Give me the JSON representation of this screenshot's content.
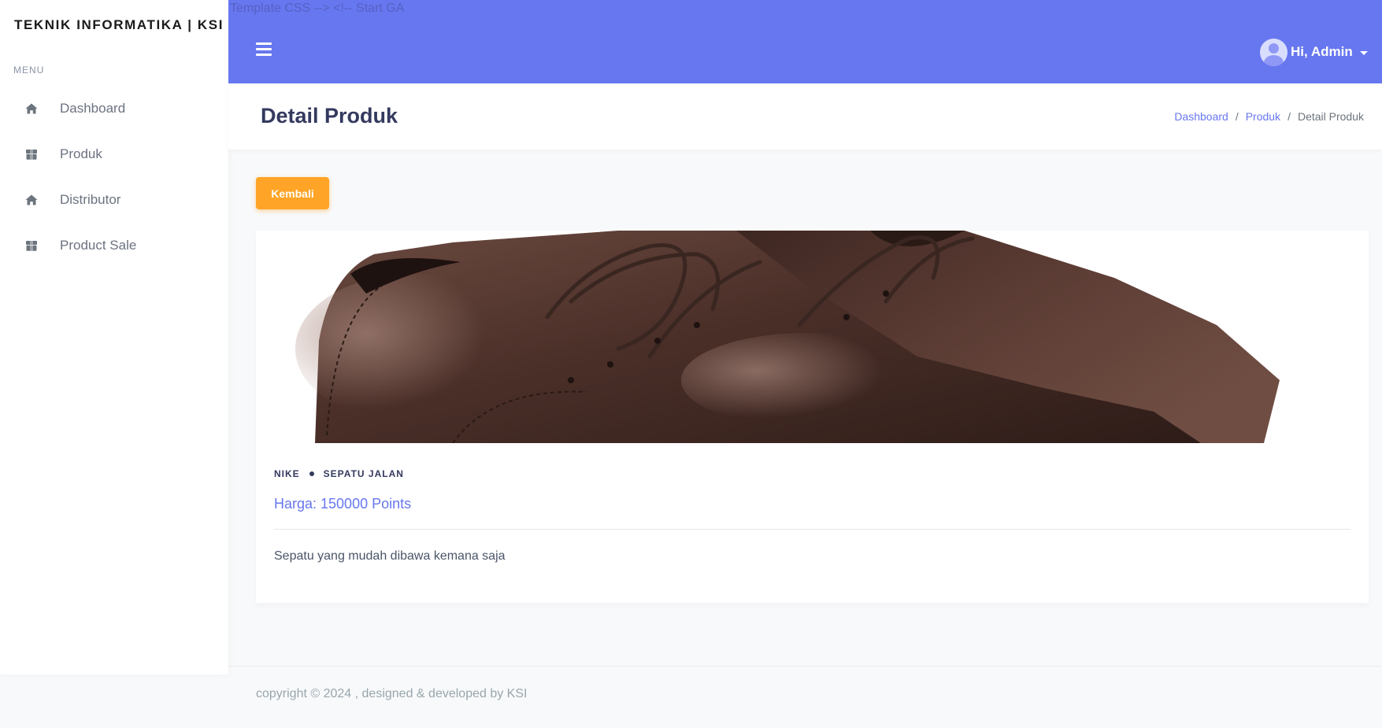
{
  "sidebar": {
    "brand": "TEKNIK INFORMATIKA | KSI",
    "menu_title": "MENU",
    "items": [
      {
        "label": "Dashboard",
        "icon": "home-icon"
      },
      {
        "label": "Produk",
        "icon": "box-icon"
      },
      {
        "label": "Distributor",
        "icon": "home-icon"
      },
      {
        "label": "Product Sale",
        "icon": "box-icon"
      }
    ]
  },
  "topbar": {
    "debug_text": "Template CSS --> <!-- Start GA",
    "user_label": "Hi, Admin",
    "color": "#6777ef"
  },
  "header": {
    "title": "Detail Produk",
    "breadcrumb": [
      "Dashboard",
      "Produk",
      "Detail Produk"
    ]
  },
  "actions": {
    "back_label": "Kembali",
    "back_color": "#ffa426"
  },
  "product": {
    "brand": "NIKE",
    "category": "SEPATU JALAN",
    "price": "Harga: 150000 Points",
    "description": "Sepatu yang mudah dibawa kemana saja",
    "image": "brown-leather-shoes"
  },
  "footer": {
    "text": "copyright © 2024 , designed & developed by KSI"
  }
}
